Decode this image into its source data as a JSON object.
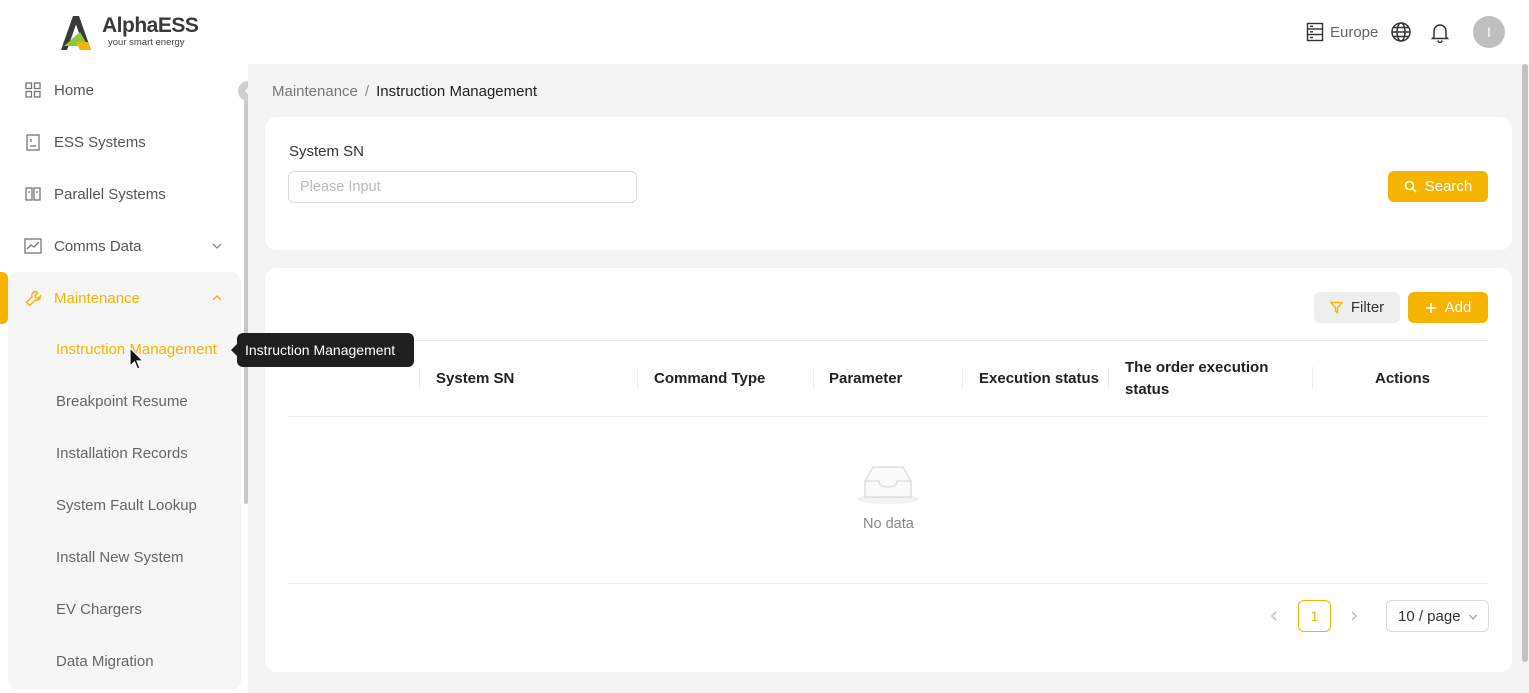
{
  "brand": {
    "name": "AlphaESS",
    "tagline": "your smart energy",
    "accent_color": "#f5b400"
  },
  "header": {
    "region_label": "Europe",
    "avatar_initial": "I",
    "icons": [
      "server-icon",
      "globe-icon",
      "bell-icon"
    ]
  },
  "sidebar": {
    "items": [
      {
        "label": "Home",
        "icon": "grid-icon"
      },
      {
        "label": "ESS Systems",
        "icon": "building-icon"
      },
      {
        "label": "Parallel Systems",
        "icon": "columns-icon"
      },
      {
        "label": "Comms Data",
        "icon": "chart-icon",
        "expandable": true
      },
      {
        "label": "Maintenance",
        "icon": "wrench-icon",
        "expanded": true,
        "active": true
      }
    ],
    "submenu": [
      {
        "label": "Instruction Management",
        "active": true
      },
      {
        "label": "Breakpoint Resume"
      },
      {
        "label": "Installation Records"
      },
      {
        "label": "System Fault Lookup"
      },
      {
        "label": "Install New System"
      },
      {
        "label": "EV Chargers"
      },
      {
        "label": "Data Migration"
      }
    ]
  },
  "tooltip": {
    "text": "Instruction Management"
  },
  "breadcrumb": {
    "parent": "Maintenance",
    "separator": "/",
    "current": "Instruction Management"
  },
  "search": {
    "field_label": "System SN",
    "placeholder": "Please Input",
    "value": "",
    "button_label": "Search"
  },
  "table": {
    "filter_label": "Filter",
    "add_label": "Add",
    "columns": [
      "System SN",
      "Command Type",
      "Parameter",
      "Execution status",
      "The order execution status",
      "Actions"
    ],
    "rows": [],
    "empty_text": "No data"
  },
  "pagination": {
    "current_page": "1",
    "page_size": "10 / page"
  }
}
